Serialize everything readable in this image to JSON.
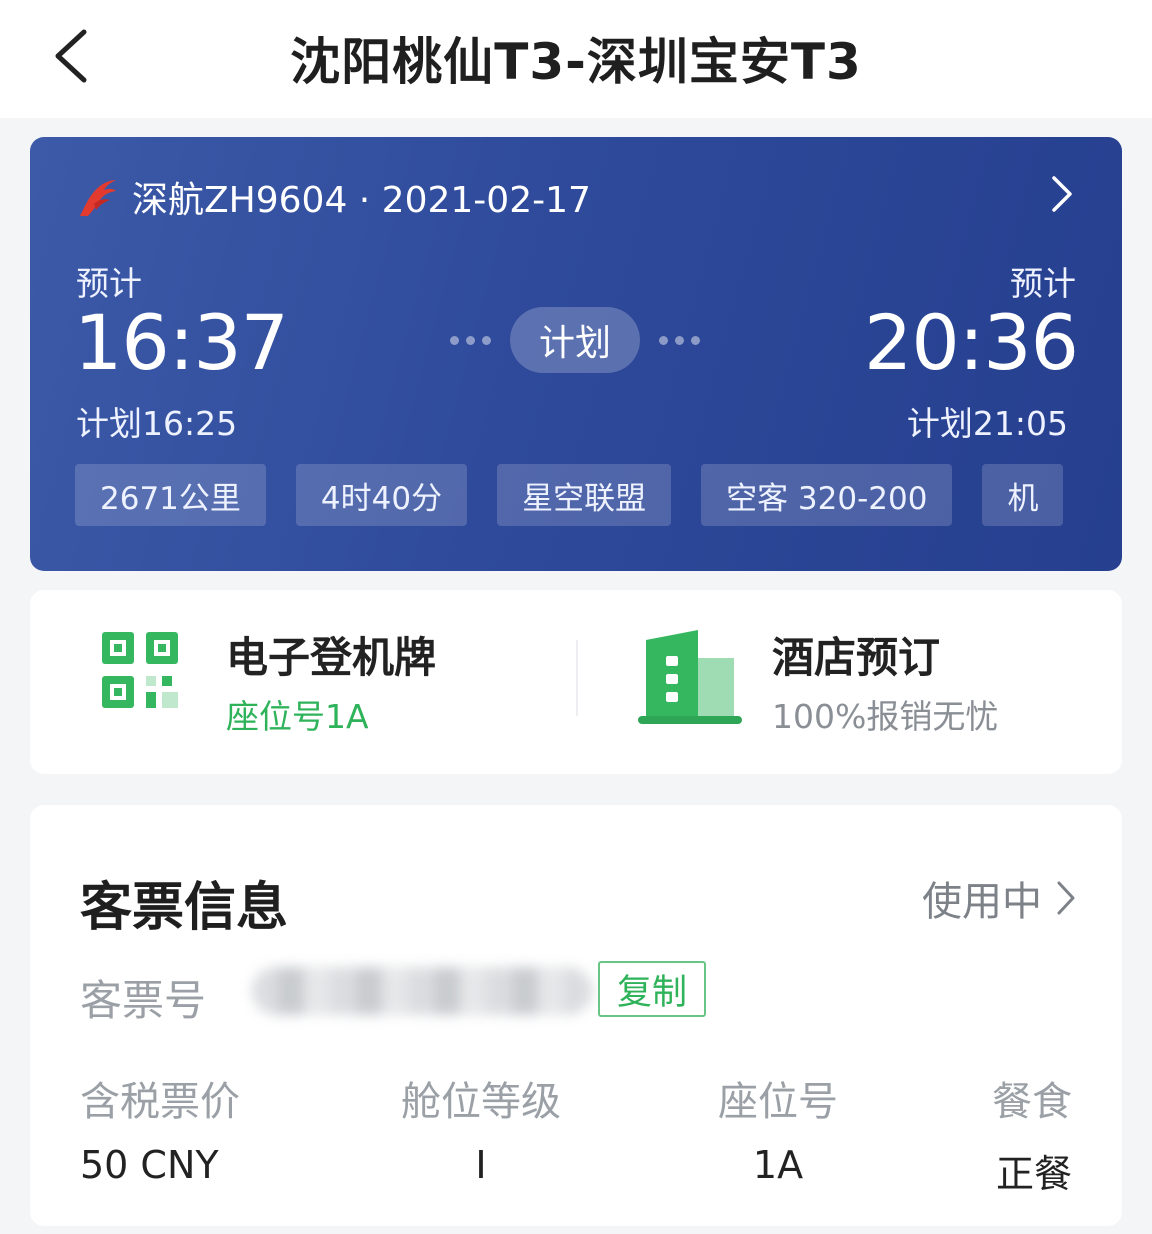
{
  "header": {
    "title": "沈阳桃仙T3-深圳宝安T3"
  },
  "flight": {
    "airline_info": "深航ZH9604 · 2021-02-17",
    "departure": {
      "label": "预计",
      "time": "16:37",
      "planned": "计划16:25"
    },
    "arrival": {
      "label": "预计",
      "time": "20:36",
      "planned": "计划21:05"
    },
    "status": "计划",
    "tags": [
      "2671公里",
      "4时40分",
      "星空联盟",
      "空客 320-200",
      "机"
    ],
    "colors": {
      "card_start": "#3c5aa8",
      "card_end": "#263f8f",
      "logo": "#e23a2e"
    }
  },
  "services": {
    "boarding_pass": {
      "title": "电子登机牌",
      "subtitle": "座位号1A",
      "icon": "qr-code-icon"
    },
    "hotel": {
      "title": "酒店预订",
      "subtitle": "100%报销无忧",
      "icon": "building-icon"
    },
    "accent_green": "#2fb35a"
  },
  "ticket": {
    "title": "客票信息",
    "status": "使用中",
    "number_label": "客票号",
    "copy_label": "复制",
    "fields": [
      {
        "label": "含税票价",
        "value": "50 CNY"
      },
      {
        "label": "舱位等级",
        "value": "I"
      },
      {
        "label": "座位号",
        "value": "1A"
      },
      {
        "label": "餐食",
        "value": "正餐"
      }
    ]
  }
}
